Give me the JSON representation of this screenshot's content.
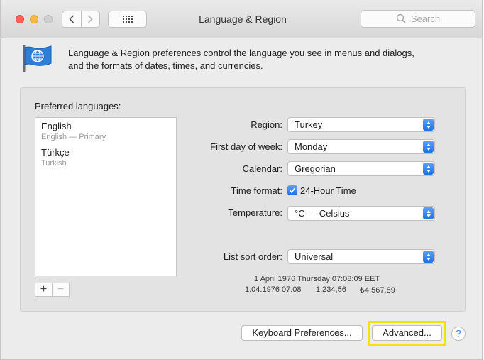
{
  "window": {
    "title": "Language & Region"
  },
  "toolbar": {
    "search_placeholder": "Search"
  },
  "intro": {
    "line1": "Language & Region preferences control the language you see in menus and dialogs,",
    "line2": "and the formats of dates, times, and currencies."
  },
  "languages": {
    "label": "Preferred languages:",
    "items": [
      {
        "name": "English",
        "sub": "English — Primary"
      },
      {
        "name": "Türkçe",
        "sub": "Turkish"
      }
    ],
    "add": "+",
    "remove": "−"
  },
  "fields": {
    "region": {
      "label": "Region:",
      "value": "Turkey"
    },
    "first_day": {
      "label": "First day of week:",
      "value": "Monday"
    },
    "calendar": {
      "label": "Calendar:",
      "value": "Gregorian"
    },
    "time_format": {
      "label": "Time format:",
      "value": "24-Hour Time",
      "checked": true
    },
    "temperature": {
      "label": "Temperature:",
      "value": "°C — Celsius"
    },
    "sort_order": {
      "label": "List sort order:",
      "value": "Universal"
    }
  },
  "sample": {
    "line1": "1 April 1976 Thursday 07:08:09 EET",
    "date_short": "1.04.1976 07:08",
    "number": "1.234,56",
    "currency": "₺4.567,89"
  },
  "buttons": {
    "keyboard": "Keyboard Preferences...",
    "advanced": "Advanced...",
    "help": "?"
  },
  "colors": {
    "accent": "#1a73e8",
    "highlight": "#f0e500"
  }
}
